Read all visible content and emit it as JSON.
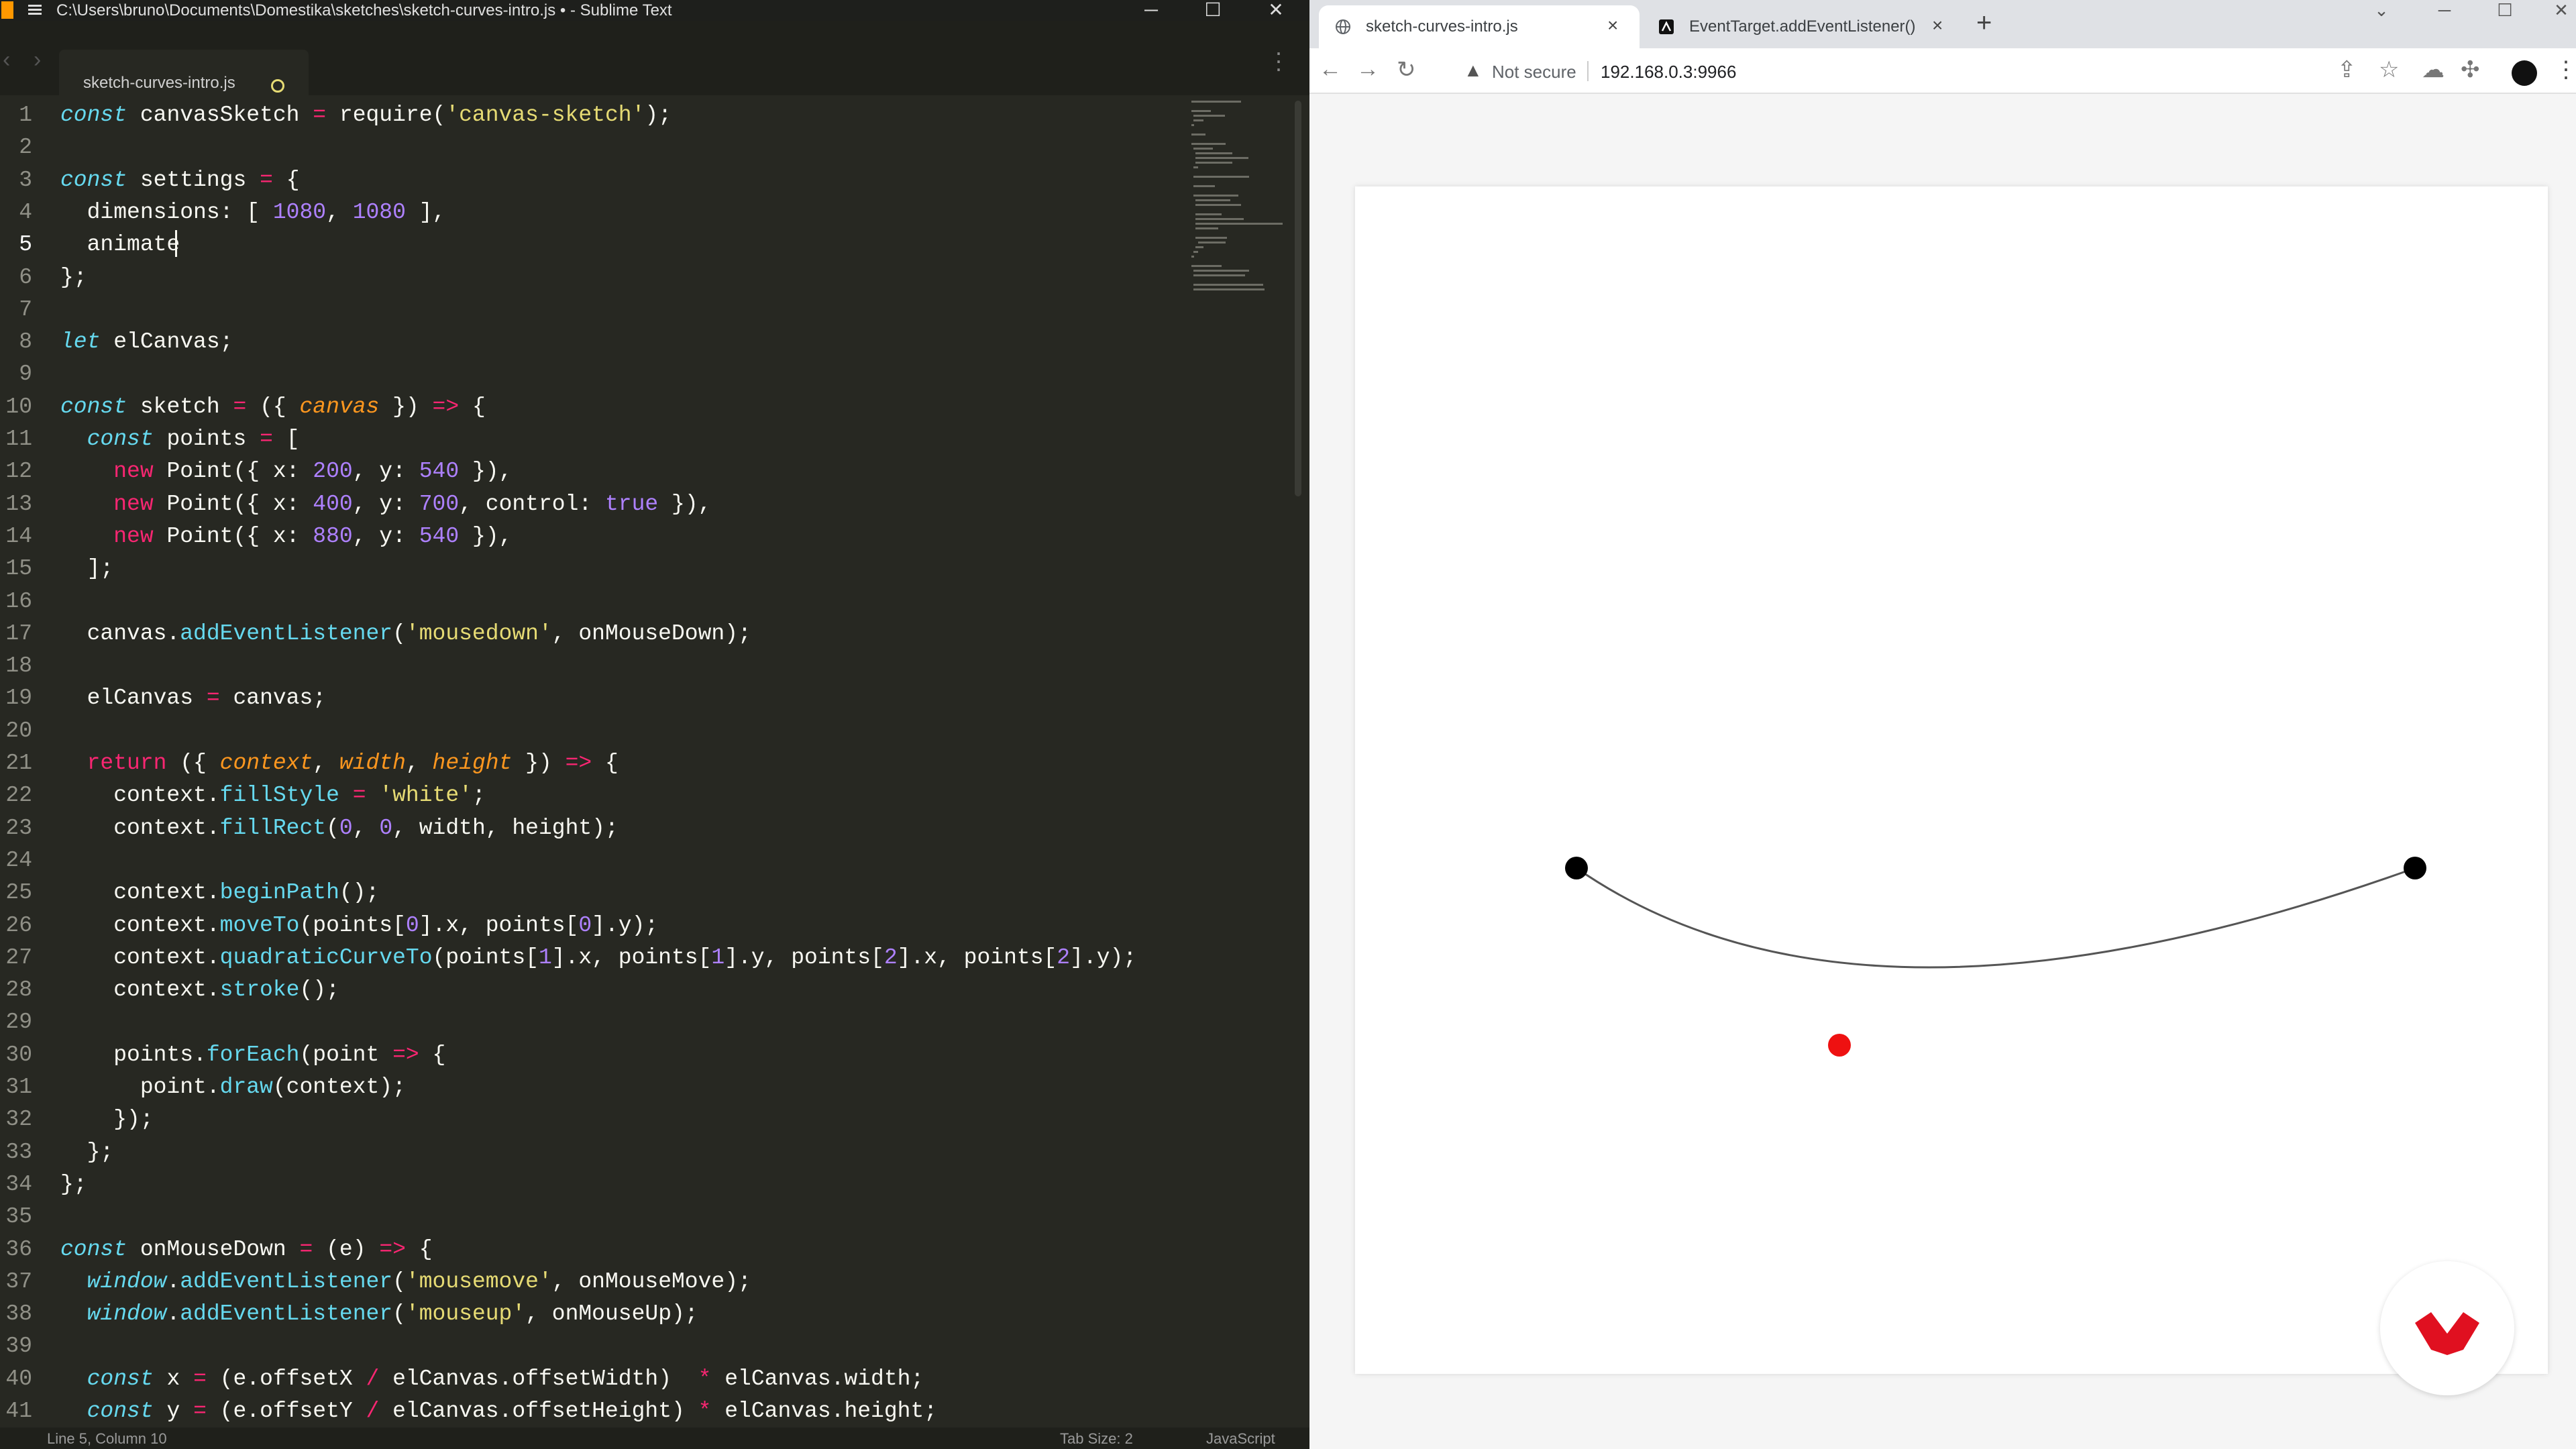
{
  "editor": {
    "title": "C:\\Users\\bruno\\Documents\\Domestika\\sketches\\sketch-curves-intro.js • - Sublime Text",
    "tab": "sketch-curves-intro.js",
    "status_position": "Line 5, Column 10",
    "status_tab_size": "Tab Size: 2",
    "status_syntax": "JavaScript",
    "line_numbers": [
      "1",
      "2",
      "3",
      "4",
      "5",
      "6",
      "7",
      "8",
      "9",
      "10",
      "11",
      "12",
      "13",
      "14",
      "15",
      "16",
      "17",
      "18",
      "19",
      "20",
      "21",
      "22",
      "23",
      "24",
      "25",
      "26",
      "27",
      "28",
      "29",
      "30",
      "31",
      "32",
      "33",
      "34",
      "35",
      "36",
      "37",
      "38",
      "39",
      "40",
      "41"
    ],
    "code": [
      "const canvasSketch = require('canvas-sketch');",
      "",
      "const settings = {",
      "  dimensions: [ 1080, 1080 ],",
      "  animate",
      "};",
      "",
      "let elCanvas;",
      "",
      "const sketch = ({ canvas }) => {",
      "  const points = [",
      "    new Point({ x: 200, y: 540 }),",
      "    new Point({ x: 400, y: 700, control: true }),",
      "    new Point({ x: 880, y: 540 }),",
      "  ];",
      "",
      "  canvas.addEventListener('mousedown', onMouseDown);",
      "",
      "  elCanvas = canvas;",
      "",
      "  return ({ context, width, height }) => {",
      "    context.fillStyle = 'white';",
      "    context.fillRect(0, 0, width, height);",
      "",
      "    context.beginPath();",
      "    context.moveTo(points[0].x, points[0].y);",
      "    context.quadraticCurveTo(points[1].x, points[1].y, points[2].x, points[2].y);",
      "    context.stroke();",
      "",
      "    points.forEach(point => {",
      "      point.draw(context);",
      "    });",
      "  };",
      "};",
      "",
      "const onMouseDown = (e) => {",
      "  window.addEventListener('mousemove', onMouseMove);",
      "  window.addEventListener('mouseup', onMouseUp);",
      "",
      "  const x = (e.offsetX / elCanvas.offsetWidth)  * elCanvas.width;",
      "  const y = (e.offsetY / elCanvas.offsetHeight) * elCanvas.height;"
    ]
  },
  "browser": {
    "tabs": [
      {
        "label": "sketch-curves-intro.js",
        "active": true
      },
      {
        "label": "EventTarget.addEventListener() -",
        "active": false
      }
    ],
    "security": "Not secure",
    "url": "192.168.0.3:9966"
  },
  "sketch": {
    "curve_color": "#555555",
    "anchor_color": "#000000",
    "control_color": "#ee1111"
  },
  "colors": {
    "editor_bg": "#272822",
    "keyword": "#66d9ef",
    "operator": "#f92672",
    "string": "#e6db74",
    "number": "#ae81ff",
    "param": "#fd971f",
    "brand": "#e01020"
  }
}
